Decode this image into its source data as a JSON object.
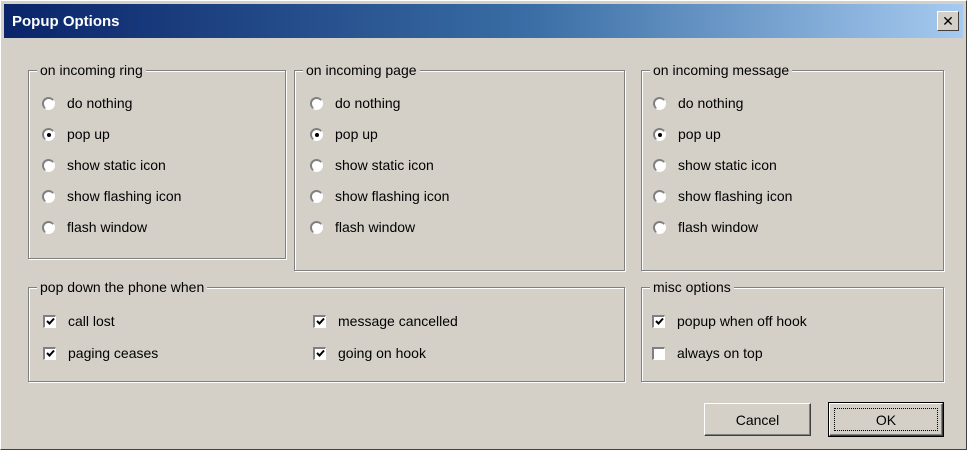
{
  "window": {
    "title": "Popup Options",
    "close_label": "✕"
  },
  "groups": {
    "ring": {
      "label": "on incoming ring",
      "options": [
        "do nothing",
        "pop up",
        "show static icon",
        "show flashing icon",
        "flash window"
      ],
      "selected": "pop up"
    },
    "page": {
      "label": "on incoming page",
      "options": [
        "do nothing",
        "pop up",
        "show static icon",
        "show flashing icon",
        "flash window"
      ],
      "selected": "pop up"
    },
    "message": {
      "label": "on incoming message",
      "options": [
        "do nothing",
        "pop up",
        "show static icon",
        "show flashing icon",
        "flash window"
      ],
      "selected": "pop up"
    },
    "popdown": {
      "label": "pop down the phone when",
      "items": [
        {
          "label": "call lost",
          "checked": true
        },
        {
          "label": "message cancelled",
          "checked": true
        },
        {
          "label": "paging ceases",
          "checked": true
        },
        {
          "label": "going on hook",
          "checked": true
        }
      ]
    },
    "misc": {
      "label": "misc options",
      "items": [
        {
          "label": "popup when off hook",
          "checked": true
        },
        {
          "label": "always on top",
          "checked": false
        }
      ]
    }
  },
  "buttons": {
    "cancel": "Cancel",
    "ok": "OK"
  }
}
